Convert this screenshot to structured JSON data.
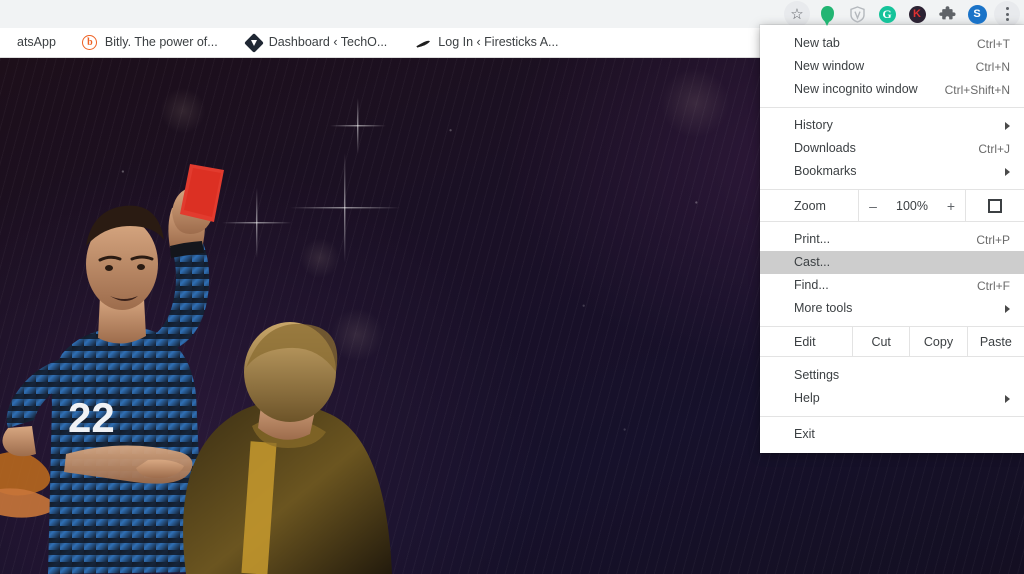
{
  "browser": {
    "toolbar_icons": [
      {
        "name": "bookmark-star-icon",
        "glyph": "☆"
      },
      {
        "name": "location-pin-icon",
        "color": "#22b573"
      },
      {
        "name": "vpn-shield-icon",
        "color": "#9aa0a6"
      },
      {
        "name": "grammarly-icon",
        "label": "G",
        "color": "#15c39a"
      },
      {
        "name": "kaspersky-icon",
        "label": "K",
        "color": "#2b2233"
      },
      {
        "name": "extensions-puzzle-icon",
        "color": "#5f6368"
      },
      {
        "name": "profile-avatar",
        "label": "S",
        "color": "#1a73c8"
      },
      {
        "name": "chrome-menu-kebab-icon",
        "color": "#5f6368"
      }
    ],
    "bookmarks": [
      {
        "label": "atsApp",
        "icon": "whatsapp-icon"
      },
      {
        "label": "Bitly. The power of...",
        "icon": "bitly-icon"
      },
      {
        "label": "Dashboard ‹ TechO...",
        "icon": "techo-diamond-icon"
      },
      {
        "label": "Log In ‹ Firesticks A...",
        "icon": "firesticks-icon"
      }
    ]
  },
  "menu": {
    "groups": [
      {
        "items": [
          {
            "label": "New tab",
            "accel": "Ctrl+T",
            "arrow": false,
            "highlighted": false
          },
          {
            "label": "New window",
            "accel": "Ctrl+N",
            "arrow": false,
            "highlighted": false
          },
          {
            "label": "New incognito window",
            "accel": "Ctrl+Shift+N",
            "arrow": false,
            "highlighted": false
          }
        ]
      },
      {
        "items": [
          {
            "label": "History",
            "accel": "",
            "arrow": true,
            "highlighted": false
          },
          {
            "label": "Downloads",
            "accel": "Ctrl+J",
            "arrow": false,
            "highlighted": false
          },
          {
            "label": "Bookmarks",
            "accel": "",
            "arrow": true,
            "highlighted": false
          }
        ]
      },
      {
        "items": [
          {
            "label": "Print...",
            "accel": "Ctrl+P",
            "arrow": false,
            "highlighted": false
          },
          {
            "label": "Cast...",
            "accel": "",
            "arrow": false,
            "highlighted": true
          },
          {
            "label": "Find...",
            "accel": "Ctrl+F",
            "arrow": false,
            "highlighted": false
          },
          {
            "label": "More tools",
            "accel": "",
            "arrow": true,
            "highlighted": false
          }
        ]
      },
      {
        "items": [
          {
            "label": "Settings",
            "accel": "",
            "arrow": false,
            "highlighted": false
          },
          {
            "label": "Help",
            "accel": "",
            "arrow": true,
            "highlighted": false
          }
        ]
      },
      {
        "items": [
          {
            "label": "Exit",
            "accel": "",
            "arrow": false,
            "highlighted": false
          }
        ]
      }
    ],
    "zoom_row": {
      "label": "Zoom",
      "minus": "–",
      "value": "100%",
      "plus": "+",
      "fullscreen_icon": "fullscreen-icon"
    },
    "edit_row": {
      "label": "Edit",
      "cut": "Cut",
      "copy": "Copy",
      "paste": "Paste"
    }
  },
  "page": {
    "scene": "soccer-referee-red-card",
    "player_number": "22",
    "colors": {
      "background_dark": "#16112b",
      "background_plum": "#1d0f1a",
      "red_card": "#e23b2e",
      "jersey_blue": "#2f6fb5",
      "jersey_gold": "#c79a2e"
    }
  }
}
